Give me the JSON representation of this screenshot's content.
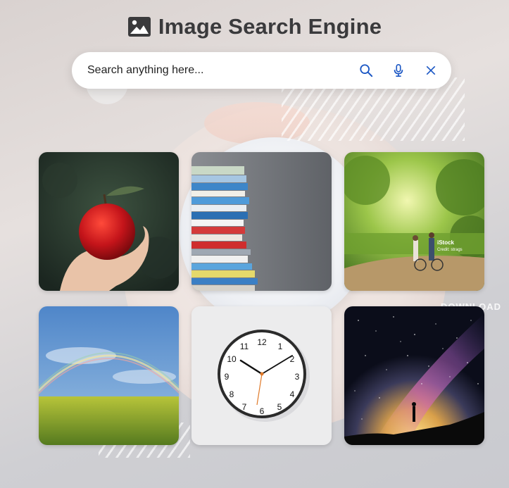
{
  "header": {
    "title": "Image Search Engine",
    "logo_icon": "image-icon"
  },
  "search": {
    "placeholder": "Search anything here...",
    "value": "",
    "icons": [
      "search-icon",
      "microphone-icon",
      "close-icon"
    ],
    "accent_color": "#1a56c4"
  },
  "results": [
    {
      "name": "apple",
      "subject": "hand holding red apple"
    },
    {
      "name": "books",
      "subject": "stack of books"
    },
    {
      "name": "forest-path",
      "subject": "couple walking bicycles in sunlit park",
      "overlay_text": [
        "iStock",
        "Credit: strags"
      ]
    },
    {
      "name": "rainbow",
      "subject": "rainbow over green field"
    },
    {
      "name": "clock",
      "subject": "wall clock",
      "numerals": [
        "12",
        "1",
        "2",
        "3",
        "4",
        "5",
        "6",
        "7",
        "8",
        "9",
        "10",
        "11"
      ]
    },
    {
      "name": "milky-way",
      "subject": "person under milky way"
    }
  ],
  "background": {
    "watermark": "DOWNLOAD"
  }
}
